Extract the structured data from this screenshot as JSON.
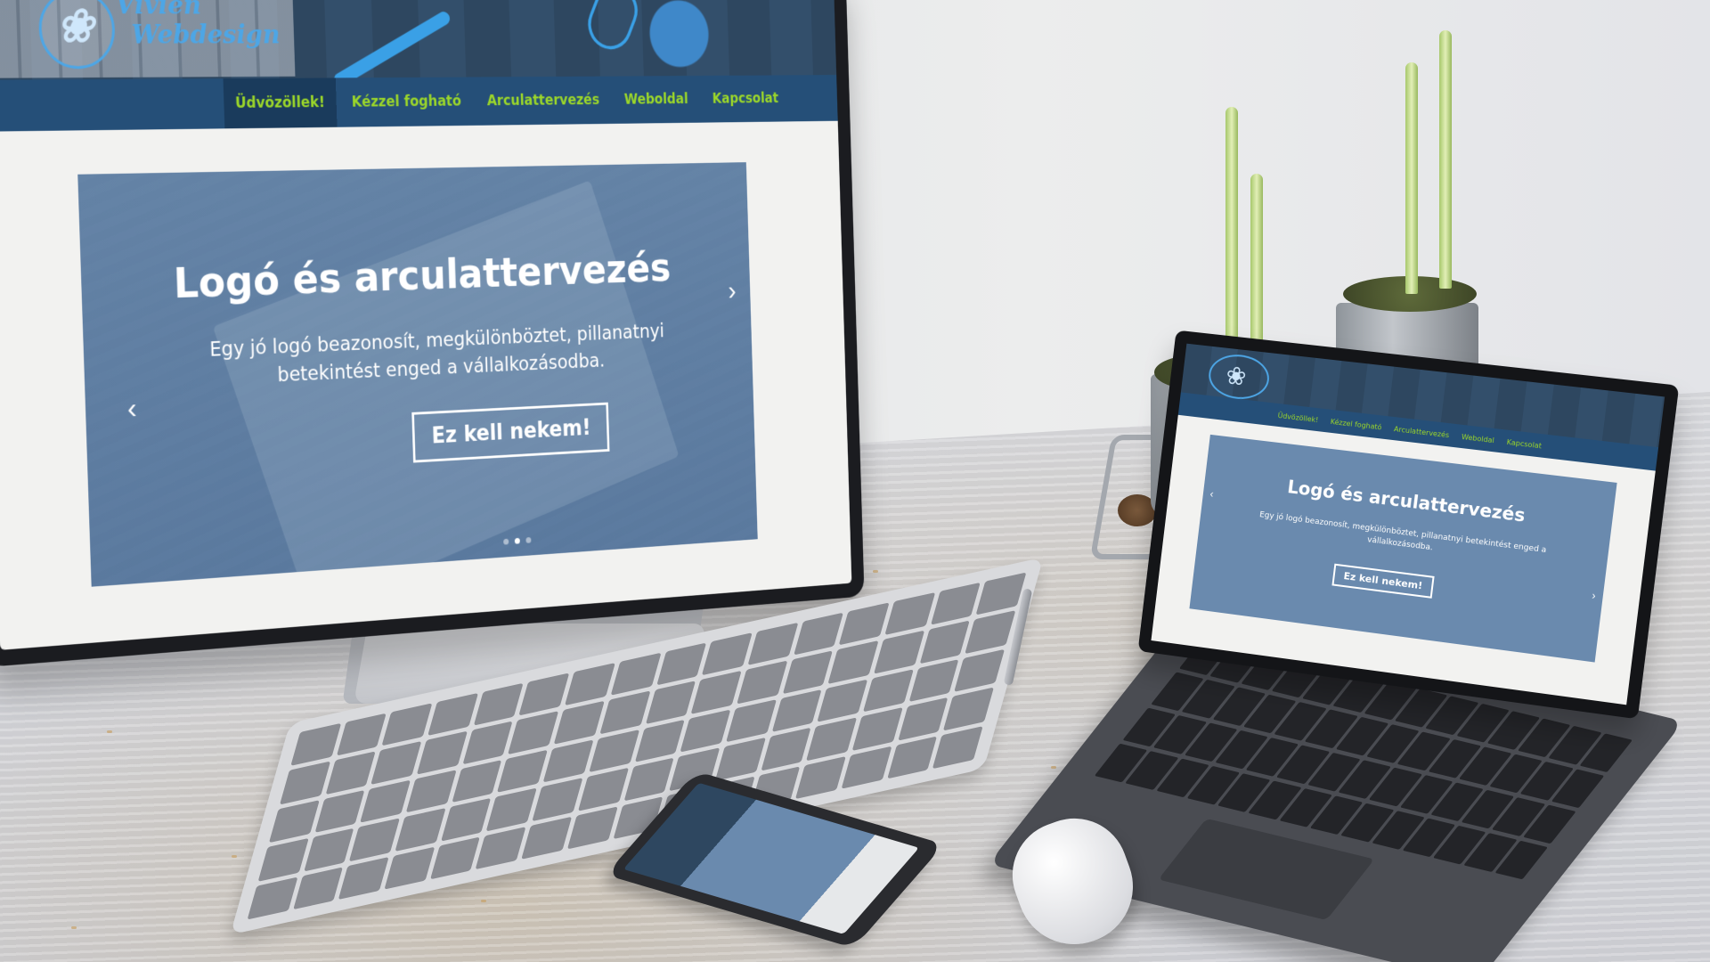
{
  "scene": {
    "description_type": "device mockup",
    "colors": {
      "nav_background": "#254f78",
      "nav_text": "#9bd62a",
      "slide_overlay": "#6a8aae",
      "slide_text": "#ffffff"
    }
  },
  "monitor_site": {
    "logo": {
      "line1": "Vivien",
      "line2": "Webdesign",
      "icon": "butterfly-icon"
    },
    "nav": [
      {
        "label": "Üdvözöllek!",
        "active": true
      },
      {
        "label": "Kézzel fogható",
        "active": false
      },
      {
        "label": "Arculattervezés",
        "active": false
      },
      {
        "label": "Weboldal",
        "active": false
      },
      {
        "label": "Kapcsolat",
        "active": false
      }
    ],
    "slide": {
      "title": "Logó és arculattervezés",
      "text": "Egy jó logó beazonosít, megkülönböztet, pillanatnyi betekintést enged a vállalkozásodba.",
      "cta": "Ez kell nekem!",
      "prev": "‹",
      "next": "›"
    }
  },
  "tablet_site": {
    "nav": [
      {
        "label": "Üdvözöllek!"
      },
      {
        "label": "Kézzel fogható"
      },
      {
        "label": "Arculattervezés"
      },
      {
        "label": "Weboldal"
      },
      {
        "label": "Kapcsolat"
      }
    ],
    "slide": {
      "title": "Logó és arculattervezés",
      "text": "Egy jó logó beazonosít, megkülönböztet, pillanatnyi betekintést enged a vállalkozásodba.",
      "cta": "Ez kell nekem!",
      "prev": "‹",
      "next": "›"
    }
  }
}
